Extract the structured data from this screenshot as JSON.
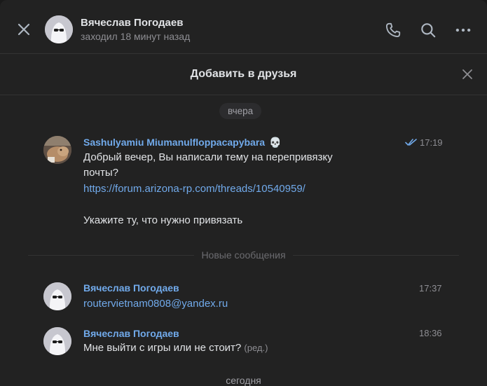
{
  "header": {
    "name": "Вячеслав Погодаев",
    "status": "заходил 18 минут назад"
  },
  "banner": {
    "title": "Добавить в друзья"
  },
  "days": {
    "yesterday": "вчера",
    "today": "сегодня"
  },
  "new_messages_label": "Новые сообщения",
  "messages": [
    {
      "author": "Sashulyamiu Miumanulfloppacapybara",
      "author_badge": "💀",
      "time": "17:19",
      "read": true,
      "lines": [
        "Добрый вечер, Вы написали тему на перепривязку",
        "почты?"
      ],
      "link": "https://forum.arizona-rp.com/threads/10540959/",
      "line_after": "Укажите ту, что нужно привязать"
    },
    {
      "author": "Вячеслав Погодаев",
      "time": "17:37",
      "link": "routervietnam0808@yandex.ru"
    },
    {
      "author": "Вячеслав Погодаев",
      "time": "18:36",
      "text": "Мне выйти с игры или не стоит?",
      "edited": "(ред.)"
    }
  ],
  "colors": {
    "accent": "#71aaeb",
    "background": "#222222",
    "muted": "#8e8e93"
  }
}
